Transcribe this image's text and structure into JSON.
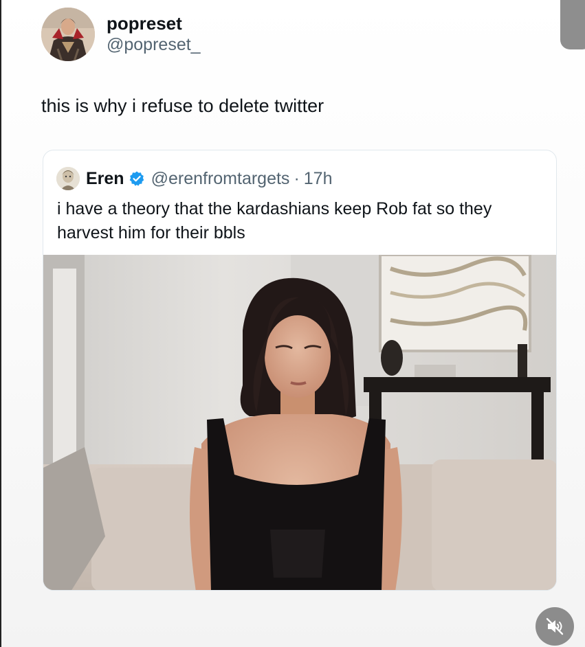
{
  "post": {
    "author_name": "popreset",
    "author_handle": "@popreset_",
    "text": "this is why i refuse to delete twitter",
    "avatar_icon": "profile-photo"
  },
  "quote": {
    "author_name": "Eren",
    "verified_icon": "verified-badge-icon",
    "author_handle": "@erenfromtargets",
    "separator": "·",
    "time": "17h",
    "text": "i have a theory that the kardashians keep Rob fat so they harvest him for their bbls",
    "media_icon": "video-still"
  },
  "controls": {
    "mute_icon": "speaker-muted-icon"
  },
  "colors": {
    "primary_text": "#0f1419",
    "secondary_text": "#536471",
    "verified_blue": "#1d9bf0",
    "card_border": "#e1e8ed"
  }
}
